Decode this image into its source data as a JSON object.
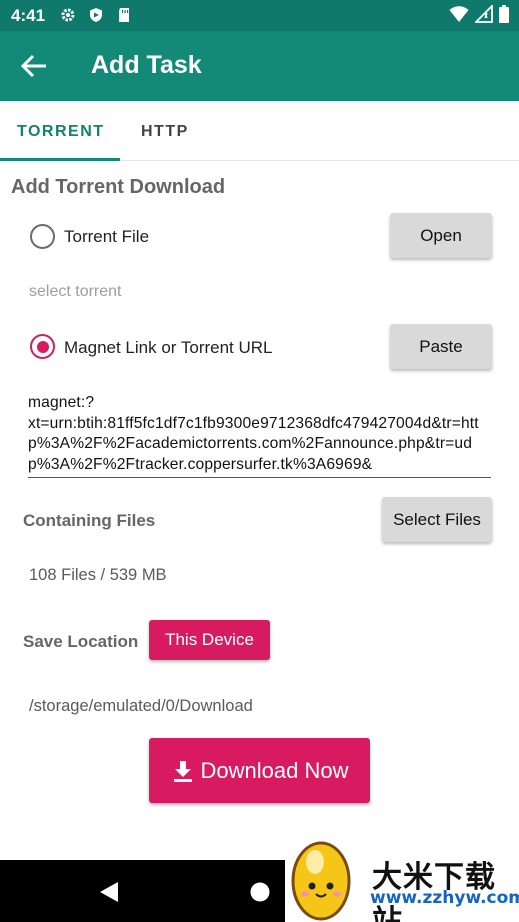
{
  "status_bar": {
    "time": "4:41"
  },
  "app_bar": {
    "title": "Add Task"
  },
  "tabs": [
    {
      "label": "TORRENT",
      "selected": true
    },
    {
      "label": "HTTP",
      "selected": false
    }
  ],
  "section_title": "Add Torrent Download",
  "torrent_file": {
    "label": "Torrent File",
    "checked": false,
    "button": "Open",
    "hint": "select torrent"
  },
  "magnet": {
    "label": "Magnet Link or Torrent URL",
    "checked": true,
    "button": "Paste",
    "value": "magnet:?\nxt=urn:btih:81ff5fc1df7c1fb9300e9712368dfc479427004d&tr=http%3A%2F%2Facademictorrents.com%2Fannounce.php&tr=udp%3A%2F%2Ftracker.coppersurfer.tk%3A6969&"
  },
  "containing_files": {
    "label": "Containing Files",
    "button": "Select Files",
    "summary": "108 Files / 539 MB"
  },
  "save_location": {
    "label": "Save Location",
    "button": "This Device",
    "path": "/storage/emulated/0/Download"
  },
  "download_button": {
    "label": "Download Now"
  },
  "watermark": {
    "text": "大米下载站",
    "url": "www.zzhyw.com"
  },
  "colors": {
    "primary": "#138a78",
    "primary_dark": "#0f7a6b",
    "accent": "#d81b60"
  }
}
